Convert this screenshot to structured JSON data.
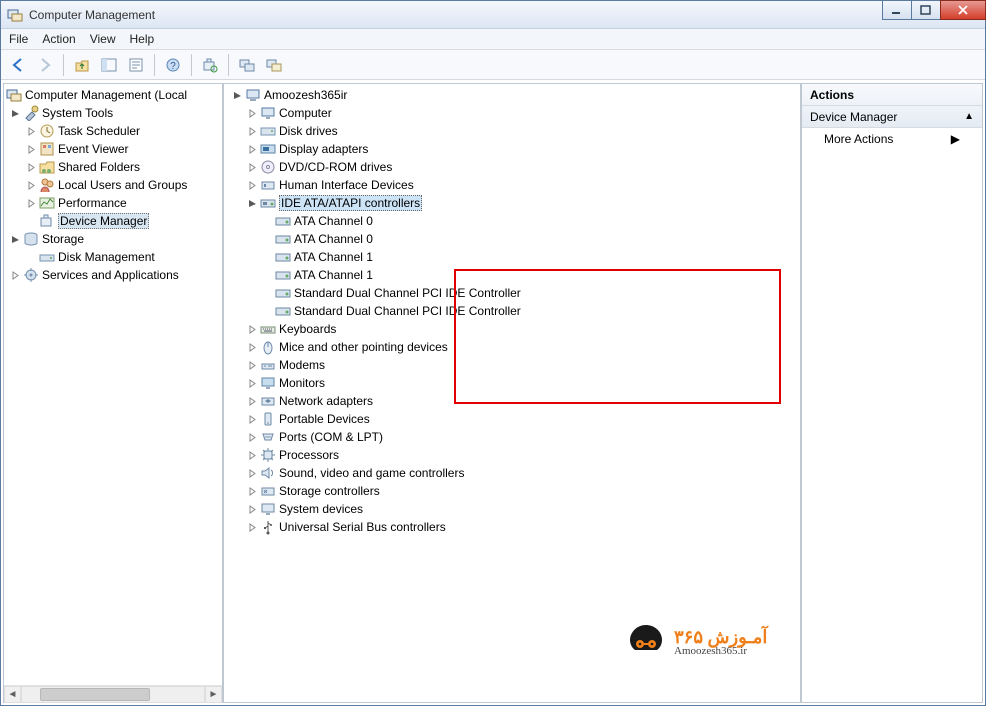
{
  "window": {
    "title": "Computer Management"
  },
  "menu": {
    "file": "File",
    "action": "Action",
    "view": "View",
    "help": "Help"
  },
  "leftTree": {
    "root": "Computer Management (Local",
    "systemTools": "System Tools",
    "taskScheduler": "Task Scheduler",
    "eventViewer": "Event Viewer",
    "sharedFolders": "Shared Folders",
    "localUsers": "Local Users and Groups",
    "performance": "Performance",
    "deviceManager": "Device Manager",
    "storage": "Storage",
    "diskMgmt": "Disk Management",
    "services": "Services and Applications"
  },
  "centerTree": {
    "root": "Amoozesh365ir",
    "computer": "Computer",
    "diskDrives": "Disk drives",
    "displayAdapters": "Display adapters",
    "dvd": "DVD/CD-ROM drives",
    "hid": "Human Interface Devices",
    "ide": "IDE ATA/ATAPI controllers",
    "ata0a": "ATA Channel 0",
    "ata0b": "ATA Channel 0",
    "ata1a": "ATA Channel 1",
    "ata1b": "ATA Channel 1",
    "stdA": "Standard Dual Channel PCI IDE Controller",
    "stdB": "Standard Dual Channel PCI IDE Controller",
    "keyboards": "Keyboards",
    "mice": "Mice and other pointing devices",
    "modems": "Modems",
    "monitors": "Monitors",
    "network": "Network adapters",
    "portable": "Portable Devices",
    "ports": "Ports (COM & LPT)",
    "processors": "Processors",
    "sound": "Sound, video and game controllers",
    "storageCtrl": "Storage controllers",
    "systemDev": "System devices",
    "usb": "Universal Serial Bus controllers"
  },
  "actions": {
    "header": "Actions",
    "deviceManager": "Device Manager",
    "moreActions": "More Actions"
  },
  "watermark": {
    "line1": "آمـوزش ۳۶۵",
    "line2": "Amoozesh365.ir"
  }
}
